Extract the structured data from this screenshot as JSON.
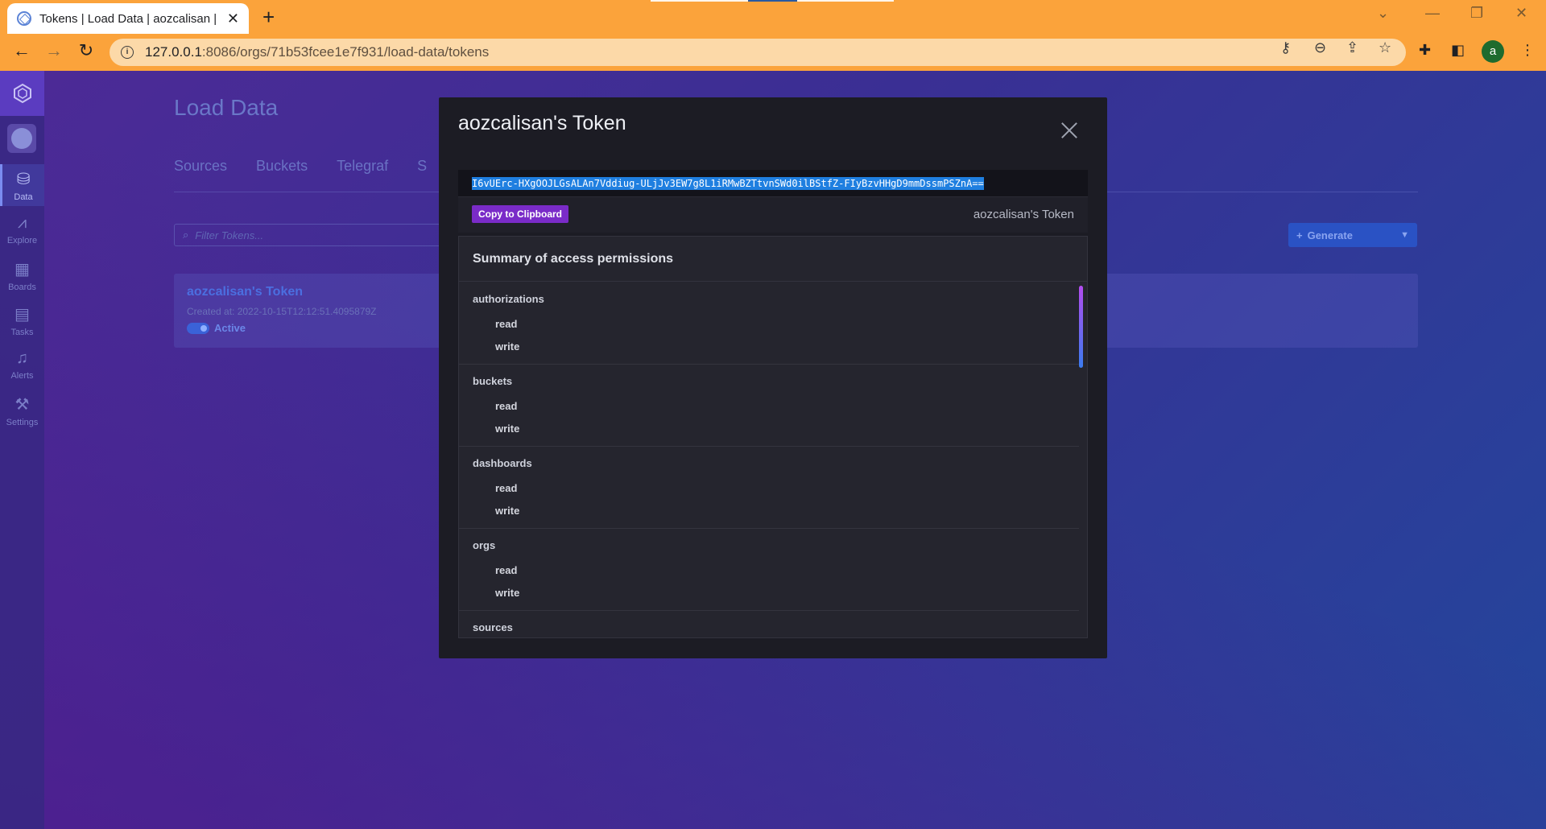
{
  "browser": {
    "tab_title": "Tokens | Load Data | aozcalisan |",
    "url_host": "127.0.0.1",
    "url_rest": ":8086/orgs/71b53fcee1e7f931/load-data/tokens",
    "profile_initial": "a"
  },
  "sidebar": {
    "items": [
      {
        "label": "Data",
        "icon": "database-icon"
      },
      {
        "label": "Explore",
        "icon": "graph-icon"
      },
      {
        "label": "Boards",
        "icon": "dashboard-icon"
      },
      {
        "label": "Tasks",
        "icon": "calendar-icon"
      },
      {
        "label": "Alerts",
        "icon": "bell-icon"
      },
      {
        "label": "Settings",
        "icon": "wrench-icon"
      }
    ]
  },
  "page": {
    "title": "Load Data",
    "tabs": [
      "Sources",
      "Buckets",
      "Telegraf",
      "S"
    ],
    "filter_placeholder": "Filter Tokens...",
    "generate_label": "Generate",
    "token_card": {
      "name": "aozcalisan's Token",
      "created": "Created at: 2022-10-15T12:12:51.4095879Z",
      "status": "Active"
    }
  },
  "modal": {
    "title": "aozcalisan's Token",
    "token_value": "I6vUErc-HXgOOJLGsALAn7Vddiug-ULjJv3EW7g8L1iRMwBZTtvnSWd0ilBStfZ-FIyBzvHHgD9mmDssmPSZnA==",
    "copy_label": "Copy to Clipboard",
    "token_description": "aozcalisan's Token",
    "permissions_header": "Summary of access permissions",
    "permissions": [
      {
        "resource": "authorizations",
        "perms": [
          "read",
          "write"
        ]
      },
      {
        "resource": "buckets",
        "perms": [
          "read",
          "write"
        ]
      },
      {
        "resource": "dashboards",
        "perms": [
          "read",
          "write"
        ]
      },
      {
        "resource": "orgs",
        "perms": [
          "read",
          "write"
        ]
      },
      {
        "resource": "sources",
        "perms": []
      }
    ]
  },
  "colors": {
    "browser_chrome": "#fba33b",
    "modal_bg": "#1c1c24",
    "selection": "#1f7fe0",
    "copy_button": "#7a2bc8"
  }
}
